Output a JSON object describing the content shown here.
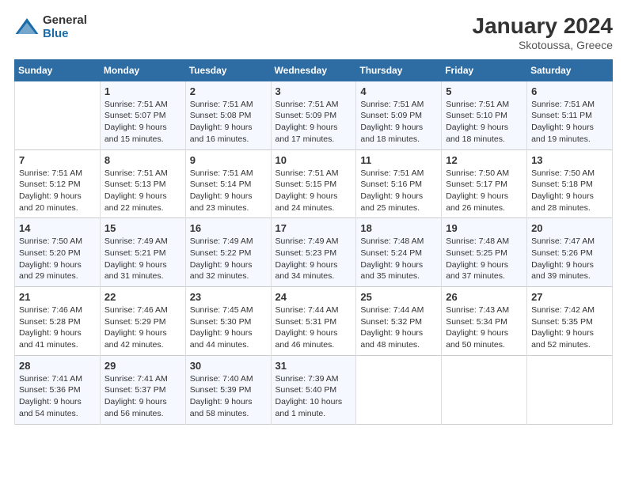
{
  "logo": {
    "general": "General",
    "blue": "Blue"
  },
  "title": "January 2024",
  "location": "Skotoussa, Greece",
  "days_header": [
    "Sunday",
    "Monday",
    "Tuesday",
    "Wednesday",
    "Thursday",
    "Friday",
    "Saturday"
  ],
  "weeks": [
    [
      {
        "num": "",
        "info": ""
      },
      {
        "num": "1",
        "info": "Sunrise: 7:51 AM\nSunset: 5:07 PM\nDaylight: 9 hours\nand 15 minutes."
      },
      {
        "num": "2",
        "info": "Sunrise: 7:51 AM\nSunset: 5:08 PM\nDaylight: 9 hours\nand 16 minutes."
      },
      {
        "num": "3",
        "info": "Sunrise: 7:51 AM\nSunset: 5:09 PM\nDaylight: 9 hours\nand 17 minutes."
      },
      {
        "num": "4",
        "info": "Sunrise: 7:51 AM\nSunset: 5:09 PM\nDaylight: 9 hours\nand 18 minutes."
      },
      {
        "num": "5",
        "info": "Sunrise: 7:51 AM\nSunset: 5:10 PM\nDaylight: 9 hours\nand 18 minutes."
      },
      {
        "num": "6",
        "info": "Sunrise: 7:51 AM\nSunset: 5:11 PM\nDaylight: 9 hours\nand 19 minutes."
      }
    ],
    [
      {
        "num": "7",
        "info": "Sunrise: 7:51 AM\nSunset: 5:12 PM\nDaylight: 9 hours\nand 20 minutes."
      },
      {
        "num": "8",
        "info": "Sunrise: 7:51 AM\nSunset: 5:13 PM\nDaylight: 9 hours\nand 22 minutes."
      },
      {
        "num": "9",
        "info": "Sunrise: 7:51 AM\nSunset: 5:14 PM\nDaylight: 9 hours\nand 23 minutes."
      },
      {
        "num": "10",
        "info": "Sunrise: 7:51 AM\nSunset: 5:15 PM\nDaylight: 9 hours\nand 24 minutes."
      },
      {
        "num": "11",
        "info": "Sunrise: 7:51 AM\nSunset: 5:16 PM\nDaylight: 9 hours\nand 25 minutes."
      },
      {
        "num": "12",
        "info": "Sunrise: 7:50 AM\nSunset: 5:17 PM\nDaylight: 9 hours\nand 26 minutes."
      },
      {
        "num": "13",
        "info": "Sunrise: 7:50 AM\nSunset: 5:18 PM\nDaylight: 9 hours\nand 28 minutes."
      }
    ],
    [
      {
        "num": "14",
        "info": "Sunrise: 7:50 AM\nSunset: 5:20 PM\nDaylight: 9 hours\nand 29 minutes."
      },
      {
        "num": "15",
        "info": "Sunrise: 7:49 AM\nSunset: 5:21 PM\nDaylight: 9 hours\nand 31 minutes."
      },
      {
        "num": "16",
        "info": "Sunrise: 7:49 AM\nSunset: 5:22 PM\nDaylight: 9 hours\nand 32 minutes."
      },
      {
        "num": "17",
        "info": "Sunrise: 7:49 AM\nSunset: 5:23 PM\nDaylight: 9 hours\nand 34 minutes."
      },
      {
        "num": "18",
        "info": "Sunrise: 7:48 AM\nSunset: 5:24 PM\nDaylight: 9 hours\nand 35 minutes."
      },
      {
        "num": "19",
        "info": "Sunrise: 7:48 AM\nSunset: 5:25 PM\nDaylight: 9 hours\nand 37 minutes."
      },
      {
        "num": "20",
        "info": "Sunrise: 7:47 AM\nSunset: 5:26 PM\nDaylight: 9 hours\nand 39 minutes."
      }
    ],
    [
      {
        "num": "21",
        "info": "Sunrise: 7:46 AM\nSunset: 5:28 PM\nDaylight: 9 hours\nand 41 minutes."
      },
      {
        "num": "22",
        "info": "Sunrise: 7:46 AM\nSunset: 5:29 PM\nDaylight: 9 hours\nand 42 minutes."
      },
      {
        "num": "23",
        "info": "Sunrise: 7:45 AM\nSunset: 5:30 PM\nDaylight: 9 hours\nand 44 minutes."
      },
      {
        "num": "24",
        "info": "Sunrise: 7:44 AM\nSunset: 5:31 PM\nDaylight: 9 hours\nand 46 minutes."
      },
      {
        "num": "25",
        "info": "Sunrise: 7:44 AM\nSunset: 5:32 PM\nDaylight: 9 hours\nand 48 minutes."
      },
      {
        "num": "26",
        "info": "Sunrise: 7:43 AM\nSunset: 5:34 PM\nDaylight: 9 hours\nand 50 minutes."
      },
      {
        "num": "27",
        "info": "Sunrise: 7:42 AM\nSunset: 5:35 PM\nDaylight: 9 hours\nand 52 minutes."
      }
    ],
    [
      {
        "num": "28",
        "info": "Sunrise: 7:41 AM\nSunset: 5:36 PM\nDaylight: 9 hours\nand 54 minutes."
      },
      {
        "num": "29",
        "info": "Sunrise: 7:41 AM\nSunset: 5:37 PM\nDaylight: 9 hours\nand 56 minutes."
      },
      {
        "num": "30",
        "info": "Sunrise: 7:40 AM\nSunset: 5:39 PM\nDaylight: 9 hours\nand 58 minutes."
      },
      {
        "num": "31",
        "info": "Sunrise: 7:39 AM\nSunset: 5:40 PM\nDaylight: 10 hours\nand 1 minute."
      },
      {
        "num": "",
        "info": ""
      },
      {
        "num": "",
        "info": ""
      },
      {
        "num": "",
        "info": ""
      }
    ]
  ]
}
